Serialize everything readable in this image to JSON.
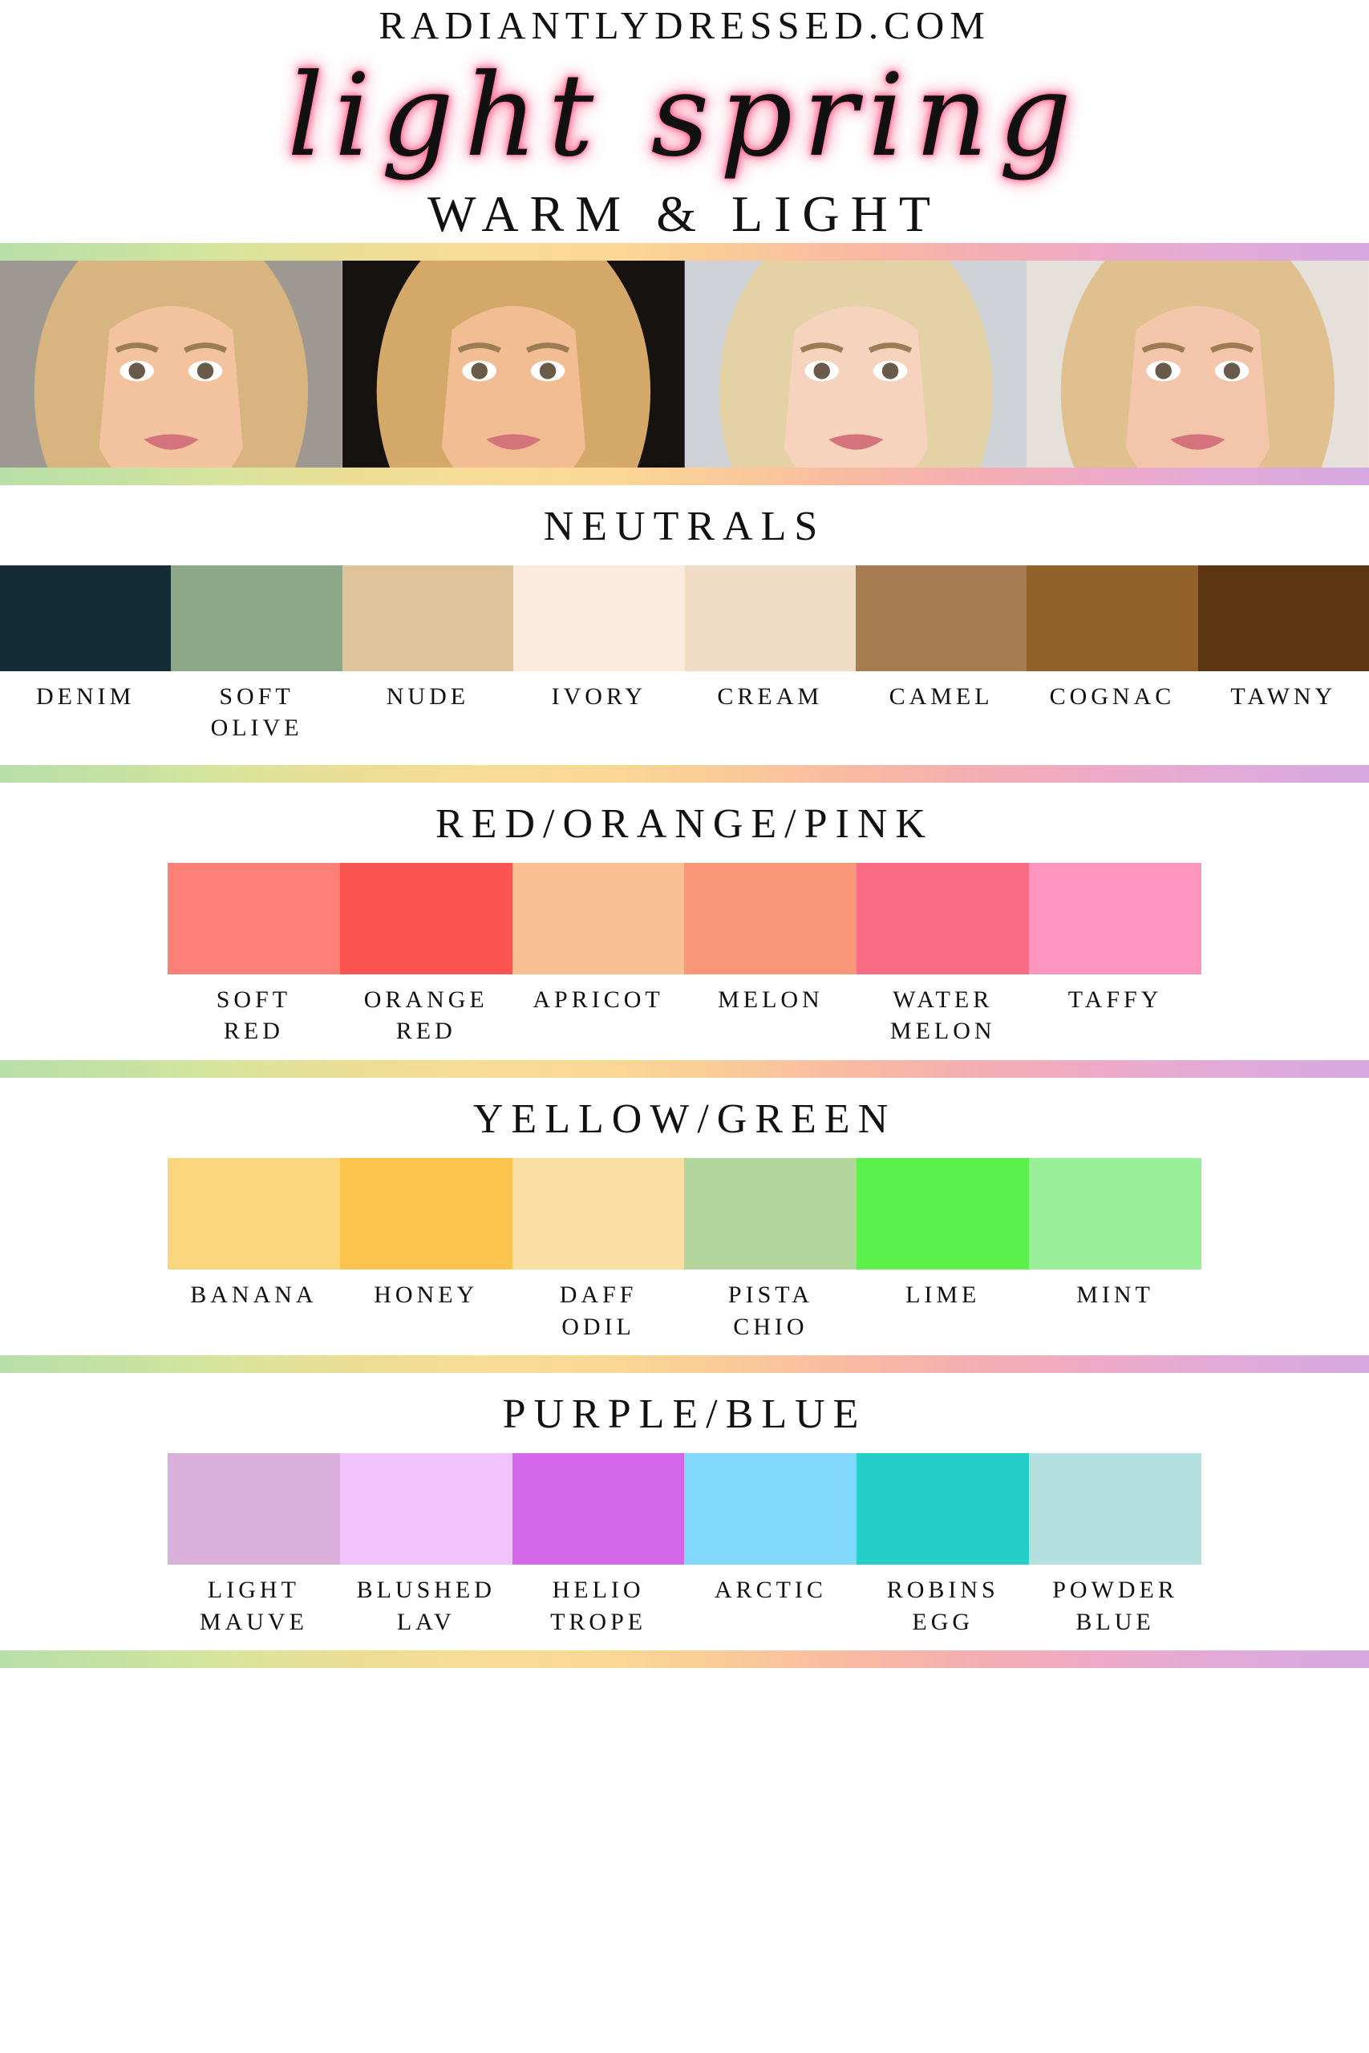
{
  "header": {
    "site_url": "RADIANTLYDRESSED.COM",
    "title": "light spring",
    "subtitle": "WARM & LIGHT",
    "title_glow_color": "#ff5f8d"
  },
  "photos": [
    {
      "name": "portrait-1",
      "alt": "blonde woman smiling, grey background"
    },
    {
      "name": "portrait-2",
      "alt": "blonde woman smiling, dark background"
    },
    {
      "name": "portrait-3",
      "alt": "blonde woman, bright patterned background"
    },
    {
      "name": "portrait-4",
      "alt": "blonde woman, light background"
    }
  ],
  "divider_gradient": [
    "#b8dfa8",
    "#d9e49c",
    "#f7dd96",
    "#fbc99a",
    "#f3aeb4",
    "#d5a9e0"
  ],
  "sections": [
    {
      "title": "NEUTRALS",
      "inset": false,
      "swatches": [
        {
          "label_lines": [
            "DENIM"
          ],
          "color": "#142c38"
        },
        {
          "label_lines": [
            "SOFT",
            "OLIVE"
          ],
          "color": "#8da888"
        },
        {
          "label_lines": [
            "NUDE"
          ],
          "color": "#dfc49b"
        },
        {
          "label_lines": [
            "IVORY"
          ],
          "color": "#fceade"
        },
        {
          "label_lines": [
            "CREAM"
          ],
          "color": "#f0dcc4"
        },
        {
          "label_lines": [
            "CAMEL"
          ],
          "color": "#a87c51"
        },
        {
          "label_lines": [
            "COGNAC"
          ],
          "color": "#91602b"
        },
        {
          "label_lines": [
            "TAWNY"
          ],
          "color": "#5c3512"
        }
      ]
    },
    {
      "title": "RED/ORANGE/PINK",
      "inset": true,
      "swatches": [
        {
          "label_lines": [
            "SOFT",
            "RED"
          ],
          "color": "#fc7f78"
        },
        {
          "label_lines": [
            "ORANGE",
            "RED"
          ],
          "color": "#fc5450"
        },
        {
          "label_lines": [
            "APRICOT"
          ],
          "color": "#f9c093"
        },
        {
          "label_lines": [
            "MELON"
          ],
          "color": "#f99878"
        },
        {
          "label_lines": [
            "WATER",
            "MELON"
          ],
          "color": "#f96a83"
        },
        {
          "label_lines": [
            "TAFFY"
          ],
          "color": "#fd95bf"
        }
      ]
    },
    {
      "title": "YELLOW/GREEN",
      "inset": true,
      "swatches": [
        {
          "label_lines": [
            "BANANA"
          ],
          "color": "#fbd67f"
        },
        {
          "label_lines": [
            "HONEY"
          ],
          "color": "#fcc44c"
        },
        {
          "label_lines": [
            "DAFF",
            "ODIL"
          ],
          "color": "#fadfa4"
        },
        {
          "label_lines": [
            "PISTA",
            "CHIO"
          ],
          "color": "#b3d69c"
        },
        {
          "label_lines": [
            "LIME"
          ],
          "color": "#5cf04c"
        },
        {
          "label_lines": [
            "MINT"
          ],
          "color": "#99f098"
        }
      ]
    },
    {
      "title": "PURPLE/BLUE",
      "inset": true,
      "swatches": [
        {
          "label_lines": [
            "LIGHT",
            "MAUVE"
          ],
          "color": "#d9afdc"
        },
        {
          "label_lines": [
            "BLUSHED",
            "LAV"
          ],
          "color": "#f0c3fc"
        },
        {
          "label_lines": [
            "HELIO",
            "TROPE"
          ],
          "color": "#d466ea"
        },
        {
          "label_lines": [
            "ARCTIC"
          ],
          "color": "#82d8fa"
        },
        {
          "label_lines": [
            "ROBINS",
            "EGG"
          ],
          "color": "#24cfca"
        },
        {
          "label_lines": [
            "POWDER",
            "BLUE"
          ],
          "color": "#b5e0e0"
        }
      ]
    }
  ]
}
